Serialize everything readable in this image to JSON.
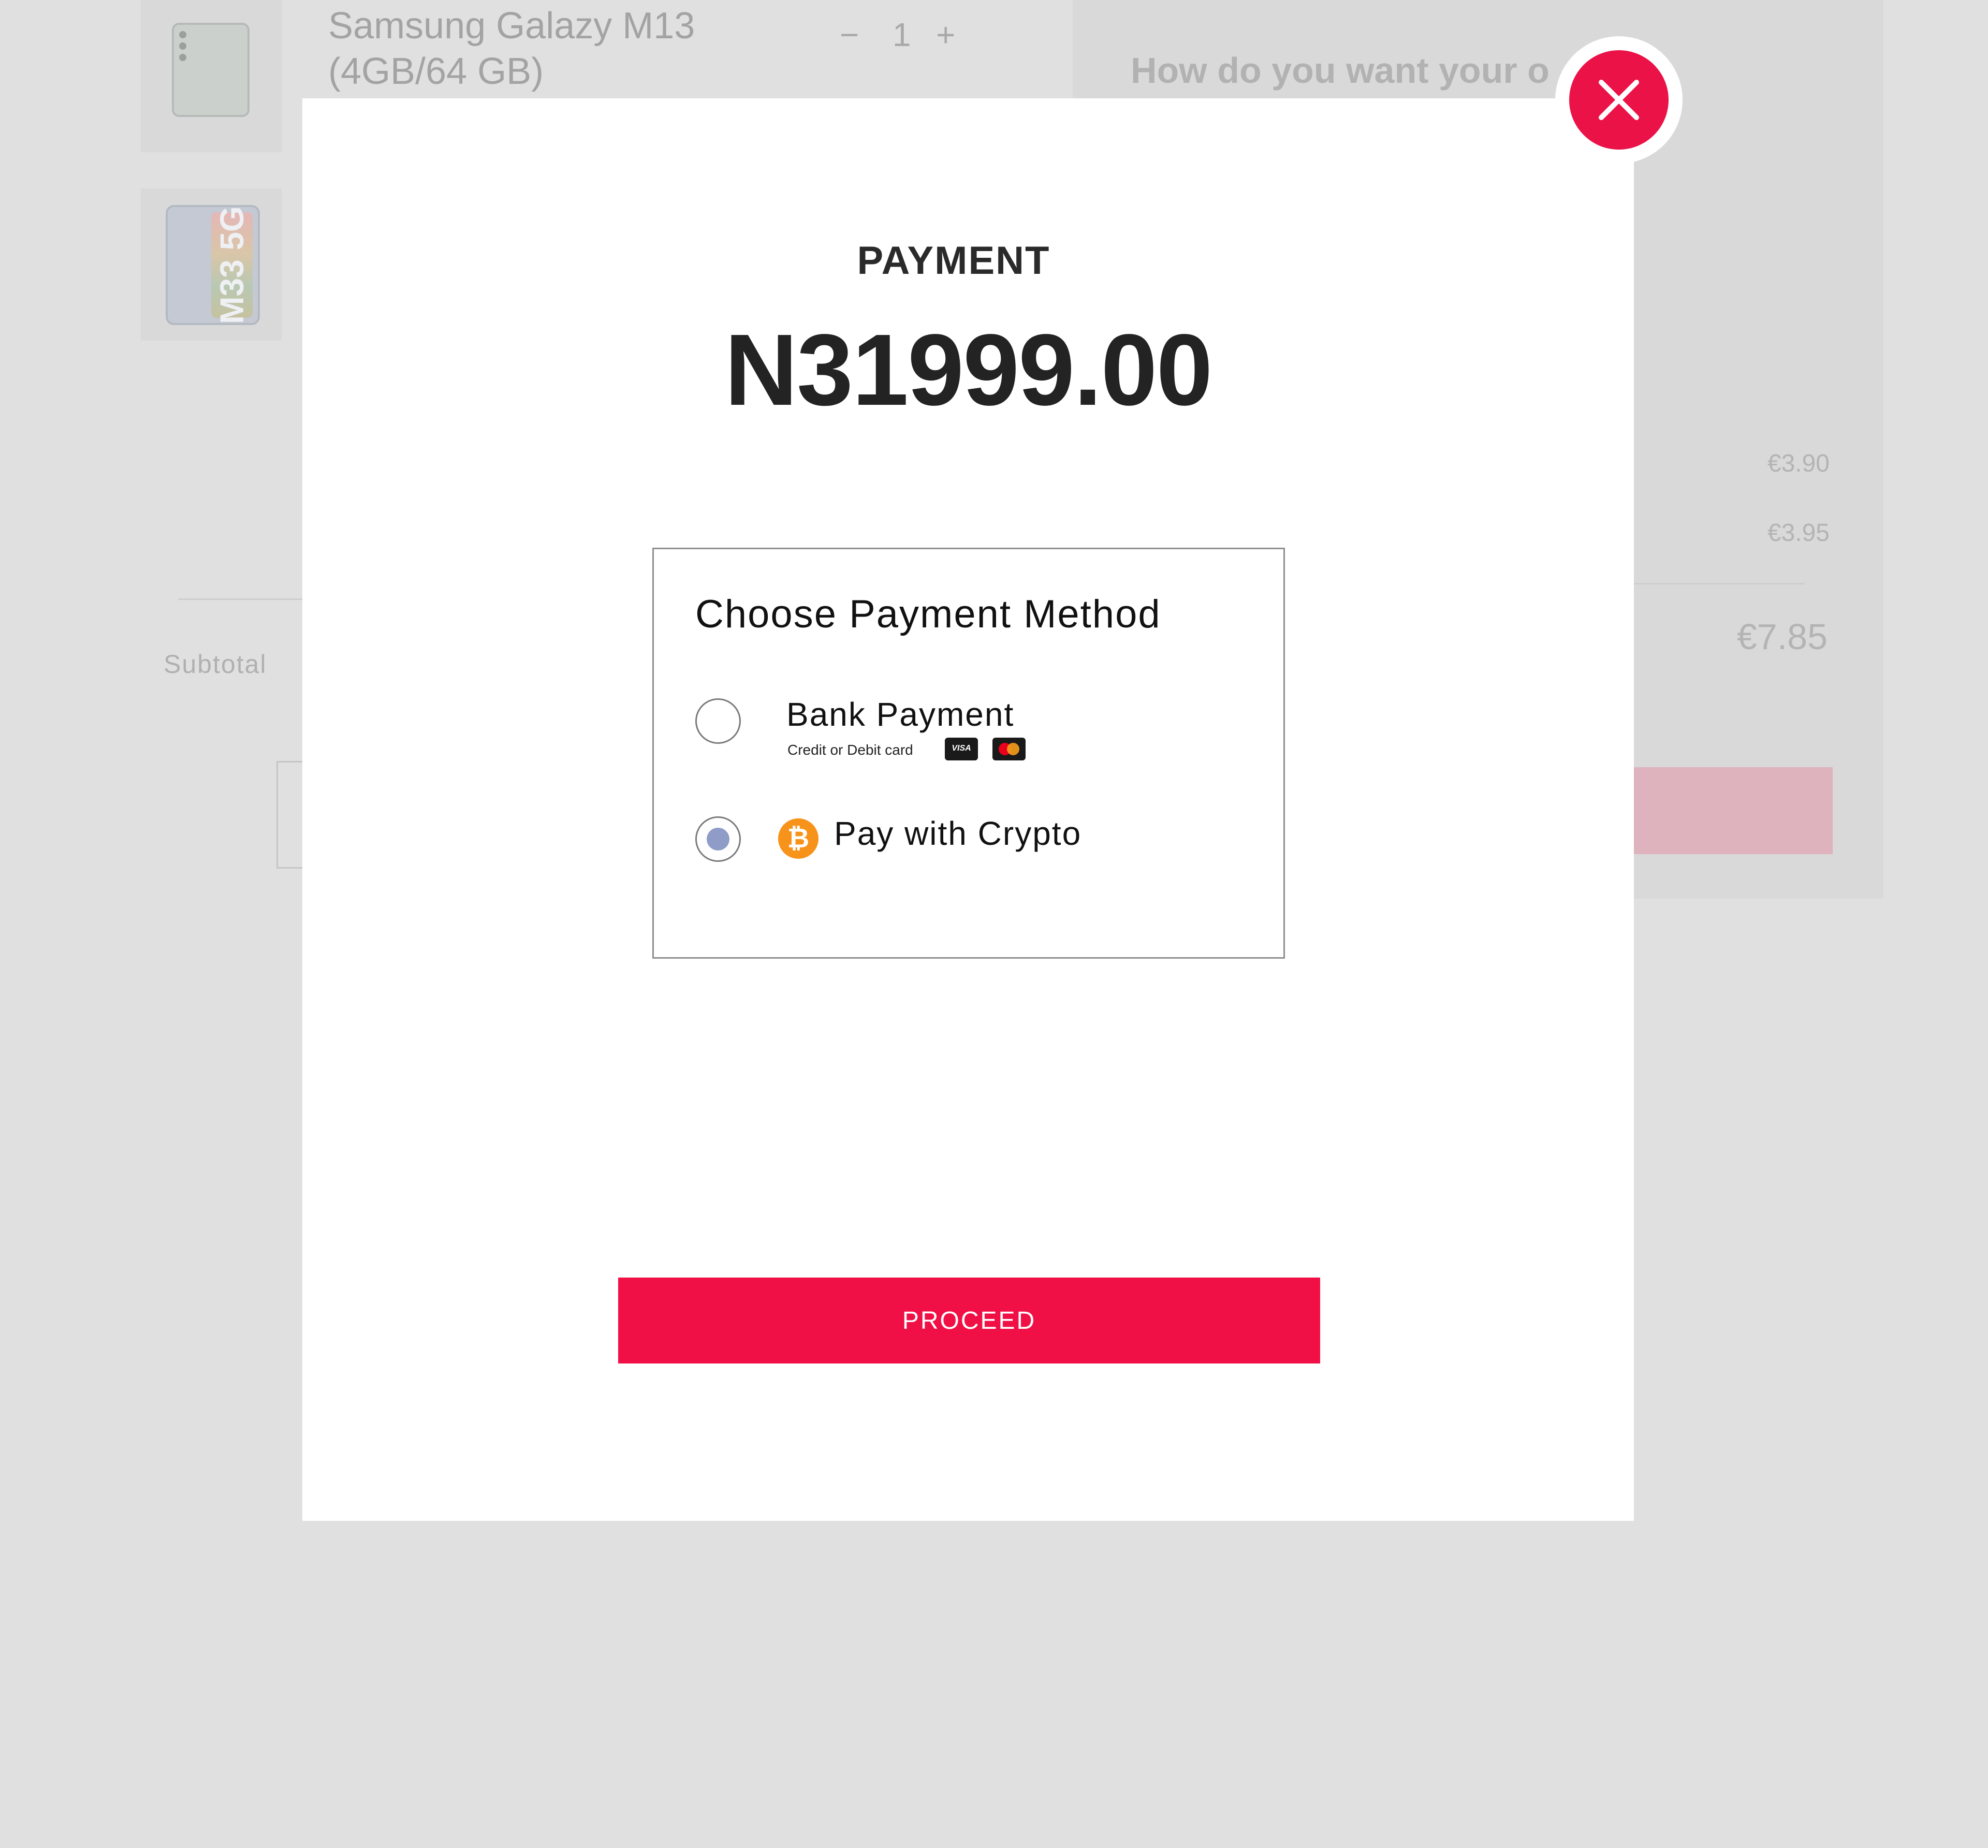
{
  "cart": {
    "items": [
      {
        "name_line1": "Samsung Galazy M13",
        "name_line2": "(4GB/64 GB)",
        "qty_minus": "−",
        "qty": "1",
        "qty_plus": "+"
      },
      {
        "thumb_label": "M33 5G"
      }
    ],
    "delivery_heading": "How do you want your o",
    "fees": [
      "€3.90",
      "€3.95"
    ],
    "total": "€7.85",
    "subtotal_label": "Subtotal"
  },
  "modal": {
    "title": "PAYMENT",
    "amount": "N31999.00",
    "payment_methods": {
      "heading": "Choose Payment Method",
      "options": [
        {
          "label": "Bank Payment",
          "sublabel": "Credit or Debit card",
          "selected": false,
          "card_icons": [
            "visa-icon",
            "mastercard-icon"
          ]
        },
        {
          "label": "Pay with Crypto",
          "selected": true,
          "icon": "bitcoin-icon"
        }
      ]
    },
    "proceed_label": "PROCEED",
    "close_icon": "close-icon"
  },
  "colors": {
    "accent": "#f01046",
    "close": "#ea1247",
    "radio_selected": "#8f9cc8",
    "bitcoin": "#f7931a",
    "overlay_background": "#e0e0e0"
  }
}
